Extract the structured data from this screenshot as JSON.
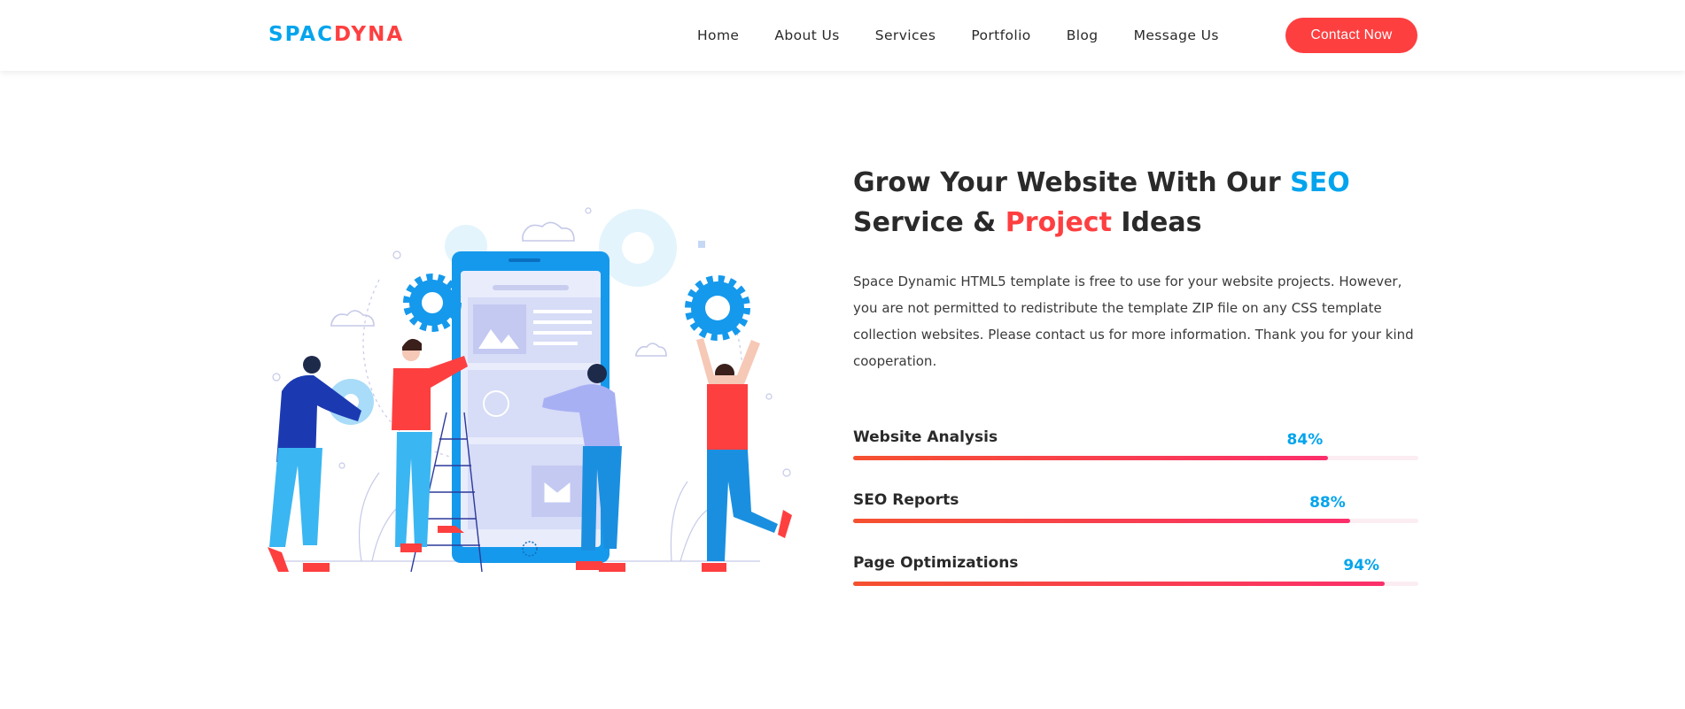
{
  "logo": {
    "part1": "SPAC",
    "part2": "DYNA"
  },
  "nav": {
    "items": [
      "Home",
      "About Us",
      "Services",
      "Portfolio",
      "Blog",
      "Message Us"
    ],
    "contact_label": "Contact Now"
  },
  "hero": {
    "title_1": "Grow Your Website With Our ",
    "title_seo": "SEO",
    "title_2": "Service & ",
    "title_project": "Project",
    "title_3": " Ideas",
    "description": "Space Dynamic HTML5 template is free to use for your website projects. However, you are not permitted to redistribute the template ZIP file on any CSS template collection websites. Please contact us for more information. Thank you for your kind cooperation."
  },
  "skills": [
    {
      "name": "Website Analysis",
      "percent_label": "84%",
      "value": 0.84
    },
    {
      "name": "SEO Reports",
      "percent_label": "88%",
      "value": 0.88
    },
    {
      "name": "Page Optimizations",
      "percent_label": "94%",
      "value": 0.94
    }
  ],
  "colors": {
    "accent_blue": "#03a4ed",
    "accent_red": "#fe3f40"
  }
}
